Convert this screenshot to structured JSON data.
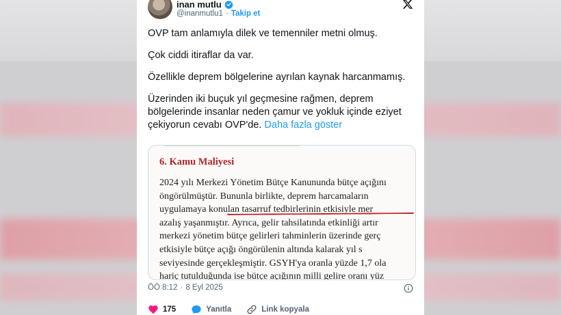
{
  "author": {
    "name": "inan mutlu",
    "handle": "@inanmutlu1",
    "separator": "·",
    "follow_label": "Takip et"
  },
  "tweet": {
    "paragraphs": [
      "OVP tam anlamıyla dilek ve temenniler metni olmuş.",
      "Çok ciddi itiraflar da var.",
      "Özellikle deprem bölgelerine ayrılan kaynak harcanmamış."
    ],
    "last_paragraph": "Üzerinden iki buçuk yıl geçmesine rağmen, deprem bölgelerinde insanlar neden çamur ve yokluk içinde eziyet çekiyorun cevabı OVP'de.",
    "show_more": "Daha fazla göster"
  },
  "document": {
    "heading": "6. Kamu Maliyesi",
    "lines": [
      "2024 yılı Merkezi Yönetim Bütçe Kanununda bütçe açığını",
      "öngörülmüştür. Bununla birlikte, deprem harcamaların",
      "uygulamaya konulan tasarruf tedbirlerinin etkisiyle mer",
      "azalış yaşanmıştır. Ayrıca, gelir tahsilatında etkinliği artır",
      "merkezi yönetim bütçe gelirleri tahminlerin üzerinde gerç",
      "etkisiyle bütçe açığı öngörülenin altında kalarak yıl s",
      "seviyesinde gerçekleşmiştir. GSYH'ya oranla yüzde 1,7 ola",
      "hariç tutulduğunda ise bütçe açığının milli gelire oranı yüz"
    ]
  },
  "meta": {
    "time": "ÖÖ 8:12",
    "separator": "·",
    "date": "8 Eyl 2025"
  },
  "actions": {
    "likes": "175",
    "reply_label": "Yanıtla",
    "copy_link_label": "Link kopyala"
  },
  "colors": {
    "link": "#1d9bf0",
    "like": "#f91880",
    "verified": "#1d9bf0",
    "doc_heading": "#b3242a",
    "underline": "#c3202b"
  },
  "icons": [
    "verified-badge-icon",
    "x-logo-icon",
    "info-icon",
    "heart-icon",
    "reply-icon",
    "link-icon"
  ]
}
